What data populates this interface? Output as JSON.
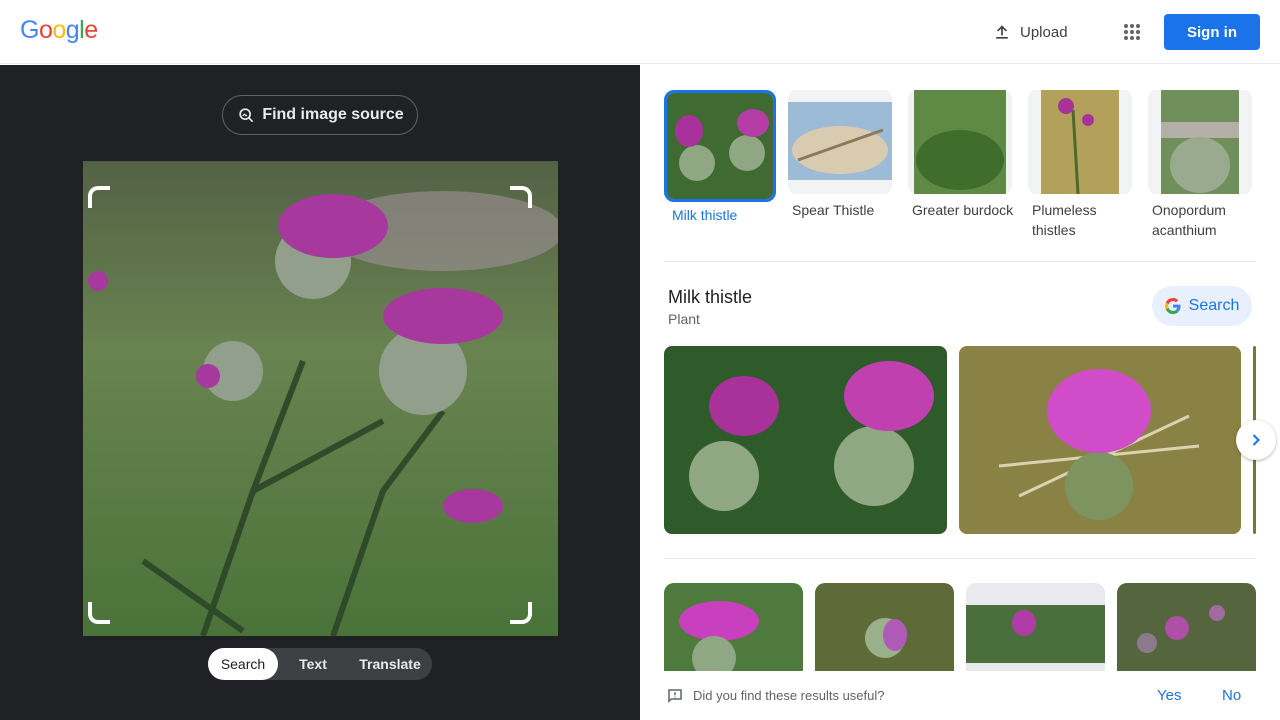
{
  "header": {
    "logo_letters": [
      "G",
      "o",
      "o",
      "g",
      "l",
      "e"
    ],
    "logo_colors": [
      "#4285f4",
      "#ea4335",
      "#fbbc05",
      "#4285f4",
      "#34a853",
      "#ea4335"
    ],
    "upload_label": "Upload",
    "apps_icon": "apps-grid-icon",
    "signin_label": "Sign in"
  },
  "left": {
    "find_source_label": "Find image source",
    "modes": [
      {
        "label": "Search",
        "active": true
      },
      {
        "label": "Text",
        "active": false
      },
      {
        "label": "Translate",
        "active": false
      }
    ]
  },
  "results": {
    "related": [
      {
        "label": "Milk thistle",
        "selected": true
      },
      {
        "label": "Spear Thistle",
        "selected": false
      },
      {
        "label": "Greater burdock",
        "selected": false
      },
      {
        "label": "Plumeless thistles",
        "selected": false
      },
      {
        "label": "Onopordum acanthium",
        "selected": false
      }
    ],
    "entity": {
      "title": "Milk thistle",
      "subtitle": "Plant",
      "search_label": "Search"
    },
    "feedback": {
      "question": "Did you find these results useful?",
      "yes_label": "Yes",
      "no_label": "No"
    }
  },
  "colors": {
    "accent": "#1a73e8",
    "dark_bg": "#202124"
  }
}
